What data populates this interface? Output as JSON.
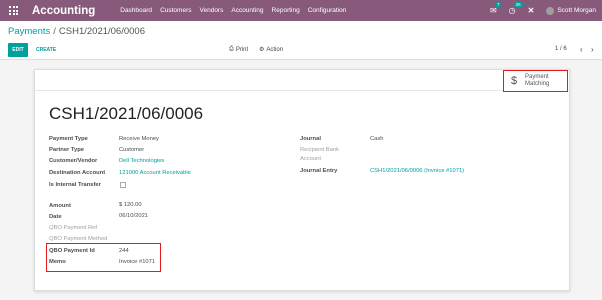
{
  "navbar": {
    "app_name": "Accounting",
    "menu": [
      "Dashboard",
      "Customers",
      "Vendors",
      "Accounting",
      "Reporting",
      "Configuration"
    ],
    "badge_messages": "7",
    "badge_activity": "26",
    "user_name": "Scott Morgan"
  },
  "breadcrumb": {
    "parent": "Payments",
    "separator": "/",
    "current": "CSH1/2021/06/0006"
  },
  "control": {
    "edit_label": "EDIT",
    "create_label": "CREATE",
    "print_label": "Print",
    "action_label": "Action",
    "pager": "1 / 6"
  },
  "smart_button": {
    "line1": "Payment",
    "line2": "Matching"
  },
  "record": {
    "title": "CSH1/2021/06/0006",
    "left": {
      "payment_type": {
        "label": "Payment Type",
        "value": "Receive Money"
      },
      "partner_type": {
        "label": "Partner Type",
        "value": "Customer"
      },
      "customer_vendor": {
        "label": "Customer/Vendor",
        "value": "Dell Technologies"
      },
      "destination_account": {
        "label": "Destination Account",
        "value": "121000 Account Receivable"
      },
      "internal_transfer": {
        "label": "Is Internal Transfer"
      },
      "amount": {
        "label": "Amount",
        "value": "$ 120.00"
      },
      "date": {
        "label": "Date",
        "value": "06/10/2021"
      },
      "qbo_payment_ref": {
        "label": "QBO Payment Ref"
      },
      "qbo_payment_method": {
        "label": "QBO Payment Method"
      },
      "qbo_payment_id": {
        "label": "QBO Payment Id",
        "value": "244"
      },
      "memo": {
        "label": "Memo",
        "value": "Invoice #1071"
      }
    },
    "right": {
      "journal": {
        "label": "Journal",
        "value": "Cash"
      },
      "recipient_bank_line1": "Recipient Bank",
      "recipient_bank_line2": "Account",
      "journal_entry": {
        "label": "Journal Entry",
        "value": "CSH1/2021/06/0006 (Invoice #1071)"
      }
    }
  },
  "colors": {
    "navbar": "#875a7b",
    "accent": "#00a09d",
    "highlight": "#e31b1b"
  }
}
